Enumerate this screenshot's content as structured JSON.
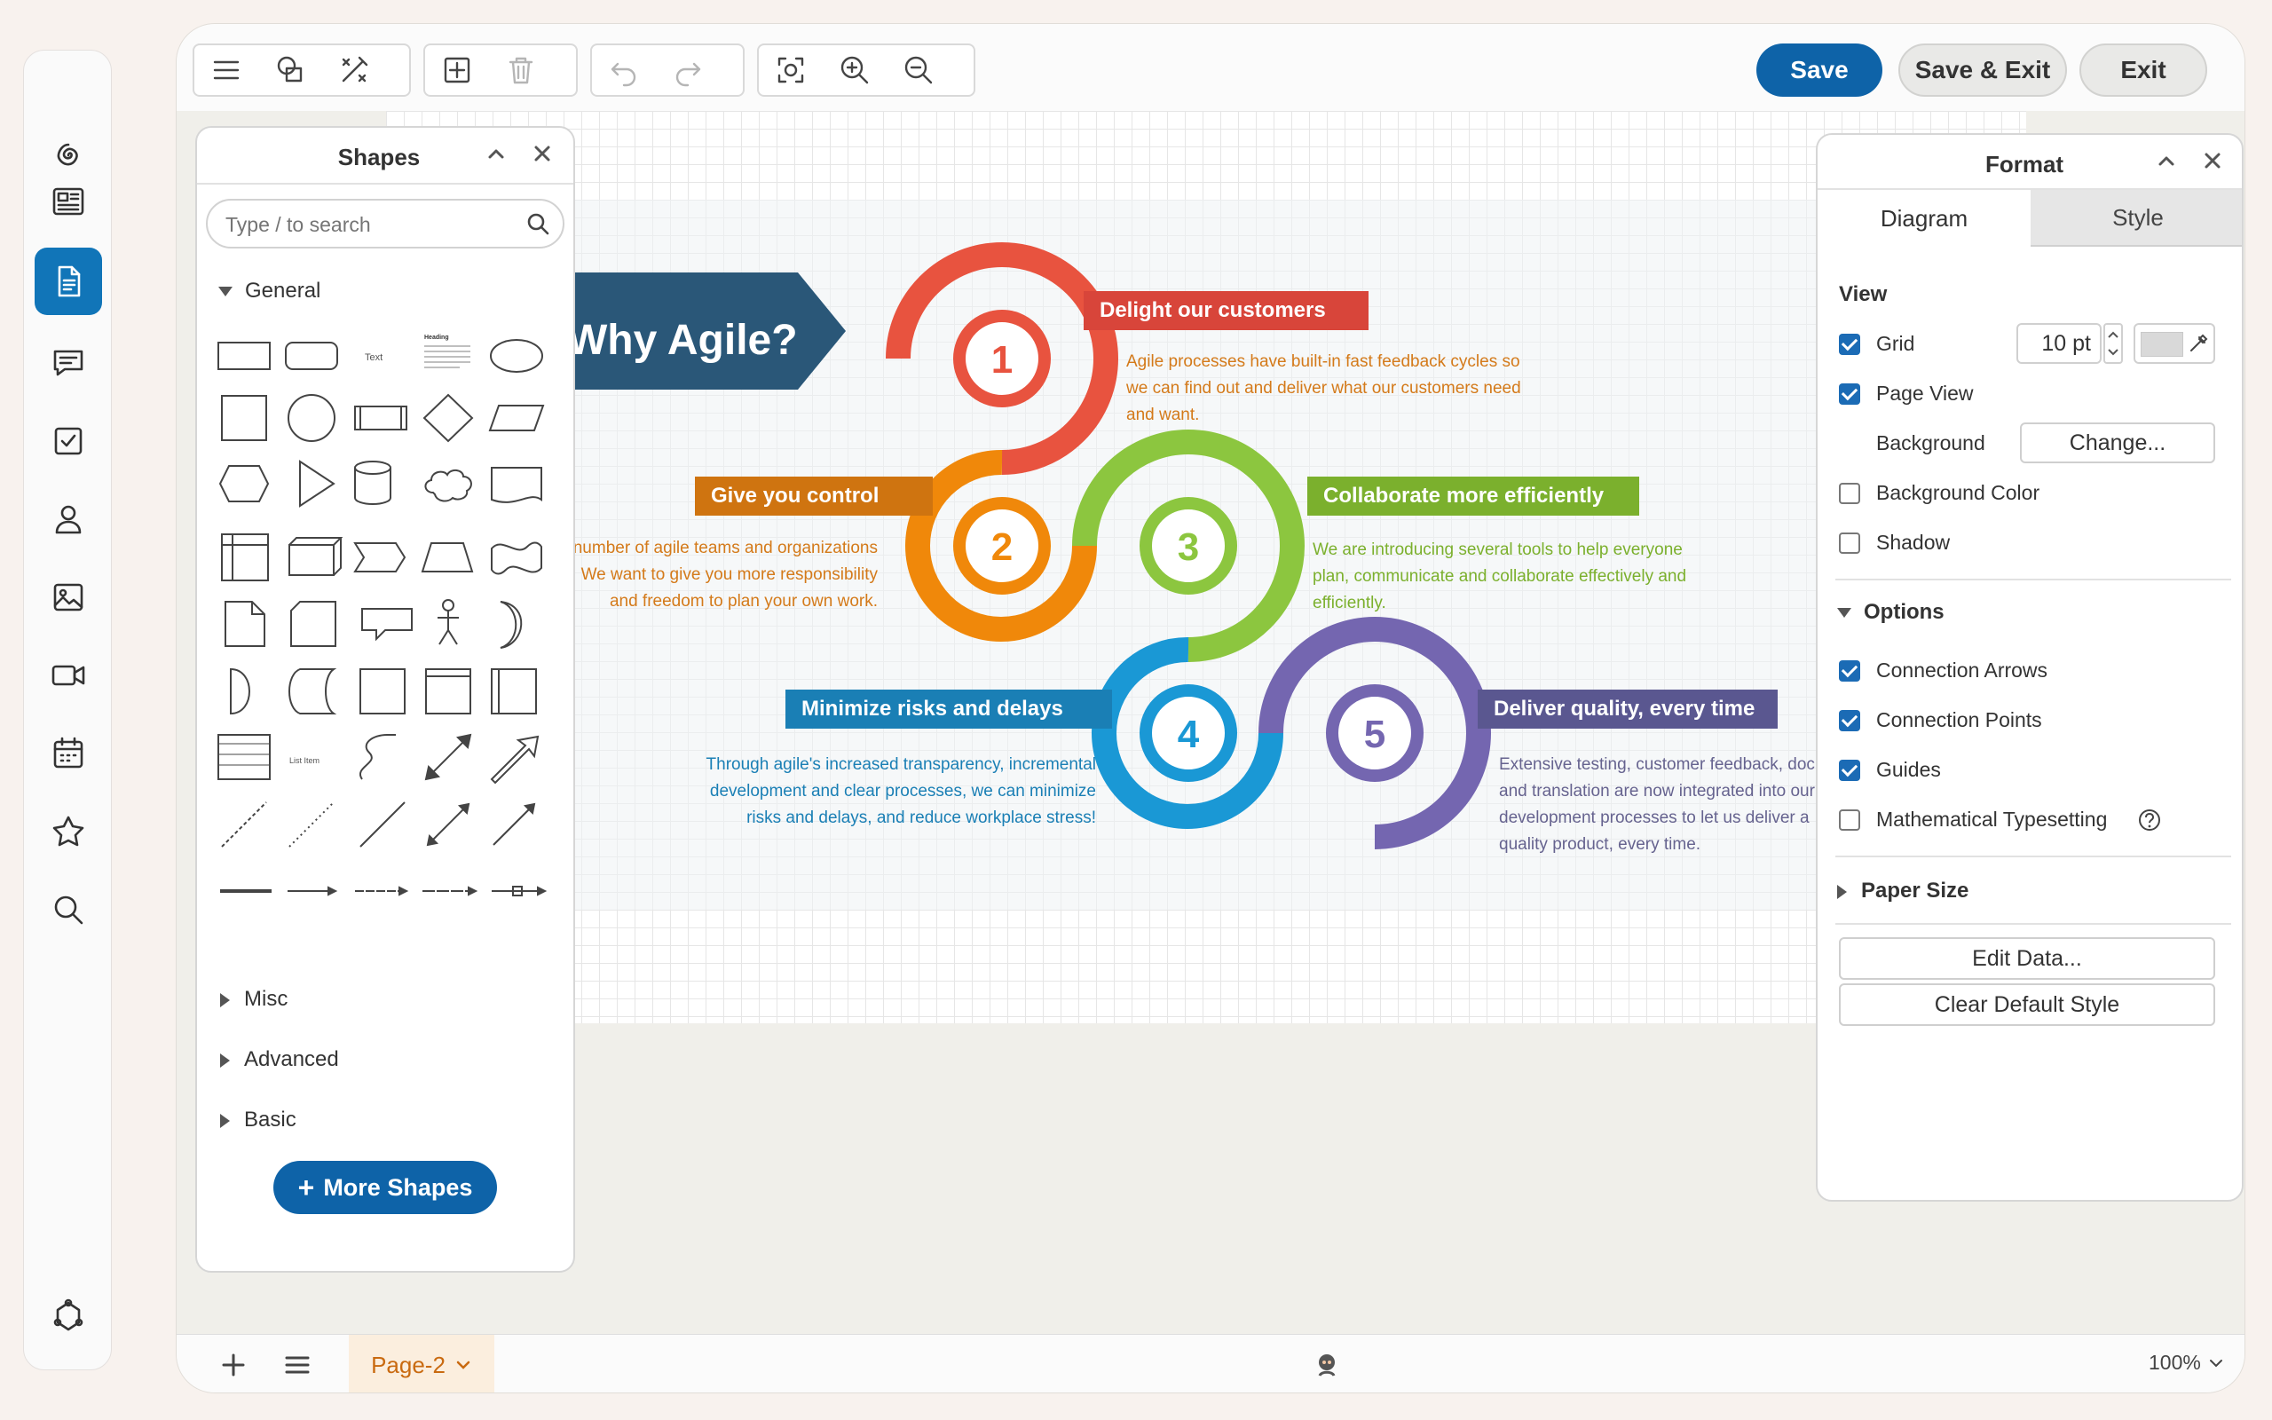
{
  "toolbar": {
    "save_label": "Save",
    "save_exit_label": "Save & Exit",
    "exit_label": "Exit"
  },
  "shapes_panel": {
    "title": "Shapes",
    "search_placeholder": "Type / to search",
    "general_label": "General",
    "misc_label": "Misc",
    "advanced_label": "Advanced",
    "basic_label": "Basic",
    "more_shapes_label": "More Shapes",
    "thumb_text": "Text",
    "thumb_heading": "Heading",
    "thumb_list_item": "List Item"
  },
  "format_panel": {
    "title": "Format",
    "tabs": [
      "Diagram",
      "Style"
    ],
    "view_label": "View",
    "grid_label": "Grid",
    "grid_size": "10 pt",
    "page_view_label": "Page View",
    "background_label": "Background",
    "change_label": "Change...",
    "background_color_label": "Background Color",
    "shadow_label": "Shadow",
    "options_label": "Options",
    "connection_arrows_label": "Connection Arrows",
    "connection_points_label": "Connection Points",
    "guides_label": "Guides",
    "math_label": "Mathematical Typesetting",
    "paper_size_label": "Paper Size",
    "edit_data_label": "Edit Data...",
    "clear_default_style_label": "Clear Default Style"
  },
  "infographic": {
    "title": "Why Agile?",
    "steps": [
      {
        "num": "1",
        "label": "Delight our customers",
        "color": "#e8533f",
        "lines": [
          "Agile processes have built-in fast feedback cycles so",
          "we can find out and deliver what our customers need",
          "and want."
        ]
      },
      {
        "num": "2",
        "label": "Give you control",
        "color": "#f0880a",
        "lines": [
          "A number of agile teams and organizations",
          "We want to give you more responsibility",
          "and freedom to plan your own work."
        ]
      },
      {
        "num": "3",
        "label": "Collaborate more efficiently",
        "color": "#8cc63f",
        "lines": [
          "We are introducing several tools to help everyone",
          "plan, communicate and collaborate effectively and",
          "efficiently."
        ]
      },
      {
        "num": "4",
        "label": "Minimize risks and delays",
        "color": "#1a98d5",
        "lines": [
          "Through agile's increased transparency, incremental",
          "development and clear processes, we can minimize",
          "risks and delays, and reduce workplace stress!"
        ]
      },
      {
        "num": "5",
        "label": "Deliver quality, every time",
        "color": "#7466b0",
        "lines": [
          "Extensive testing, customer feedback, documentation",
          "and translation are now integrated into our",
          "development processes to let us deliver a",
          "quality product, every time."
        ]
      }
    ]
  },
  "bottombar": {
    "page_tab": "Page-2",
    "zoom": "100%"
  },
  "colors": {
    "accent": "#1175b8",
    "title_banner": "#2a5778"
  }
}
